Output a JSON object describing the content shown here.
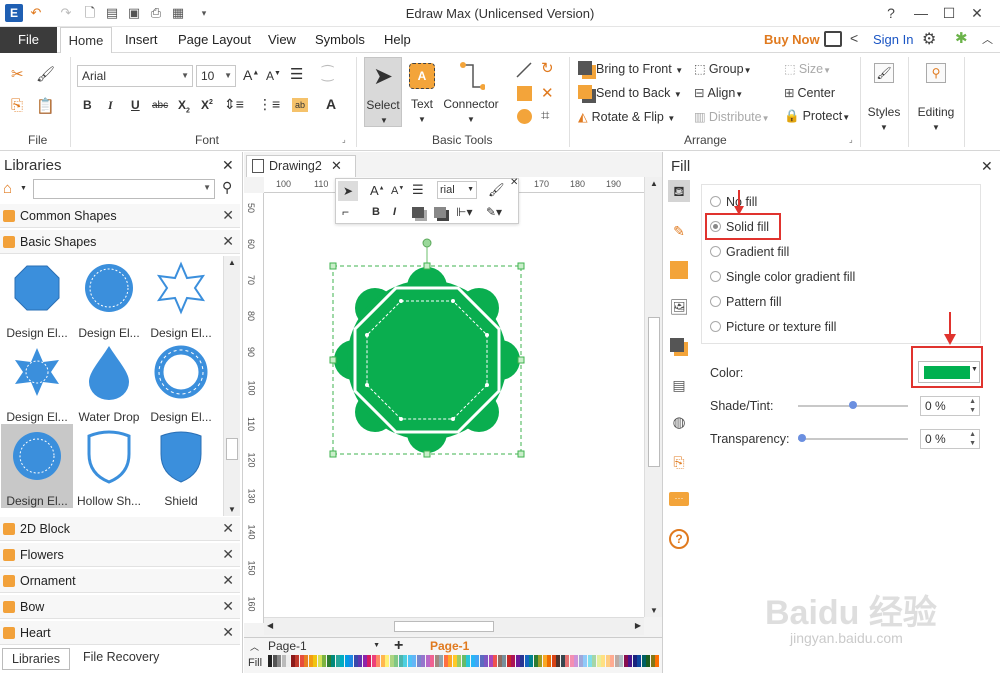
{
  "app": {
    "title": "Edraw Max (Unlicensed Version)",
    "buy_now": "Buy Now",
    "sign_in": "Sign In"
  },
  "menu": {
    "file": "File",
    "items": [
      "Home",
      "Insert",
      "Page Layout",
      "View",
      "Symbols",
      "Help"
    ]
  },
  "ribbon": {
    "file_group": "File",
    "font_group": "Font",
    "basic_tools_group": "Basic Tools",
    "arrange_group": "Arrange",
    "font_name": "Arial",
    "font_size": "10",
    "tools": {
      "select": "Select",
      "text": "Text",
      "connector": "Connector"
    },
    "arrange": {
      "bring_to_front": "Bring to Front",
      "send_to_back": "Send to Back",
      "rotate_flip": "Rotate & Flip",
      "group": "Group",
      "align": "Align",
      "distribute": "Distribute",
      "size": "Size",
      "center": "Center",
      "protect": "Protect"
    },
    "styles": "Styles",
    "editing": "Editing"
  },
  "libraries": {
    "title": "Libraries",
    "categories": [
      "Common Shapes",
      "Basic Shapes"
    ],
    "shapes": [
      "Design El...",
      "Design El...",
      "Design El...",
      "Design El...",
      "Water Drop",
      "Design El...",
      "Design El...",
      "Hollow Sh...",
      "Shield"
    ],
    "lower_categories": [
      "2D Block",
      "Flowers",
      "Ornament",
      "Bow",
      "Heart"
    ],
    "bottom_tabs": [
      "Libraries",
      "File Recovery"
    ]
  },
  "document": {
    "tab": "Drawing2",
    "ruler_h": [
      "100",
      "110",
      "170",
      "180",
      "190"
    ],
    "ruler_v": [
      "50",
      "60",
      "70",
      "80",
      "90",
      "100",
      "110",
      "120",
      "130",
      "140",
      "150",
      "160"
    ],
    "mini_font": "rial",
    "page_tab": "Page-1",
    "page_tab_active": "Page-1",
    "fill_label": "Fill"
  },
  "fill_panel": {
    "title": "Fill",
    "options": [
      "No fill",
      "Solid fill",
      "Gradient fill",
      "Single color gradient fill",
      "Pattern fill",
      "Picture or texture fill"
    ],
    "selected": "Solid fill",
    "color_label": "Color:",
    "color_value": "#00b050",
    "shade_label": "Shade/Tint:",
    "shade_value": "0 %",
    "shade_level": 0.5,
    "transparency_label": "Transparency:",
    "transparency_value": "0 %",
    "transparency_level": 0
  },
  "watermark": {
    "line1": "Baidu 经验",
    "line2": "jingyan.baidu.com"
  },
  "colors": {
    "accent": "#e0332e",
    "shape_fill": "#0aae4f",
    "library_blue": "#3b8fdc",
    "star": "#f2a13a"
  }
}
